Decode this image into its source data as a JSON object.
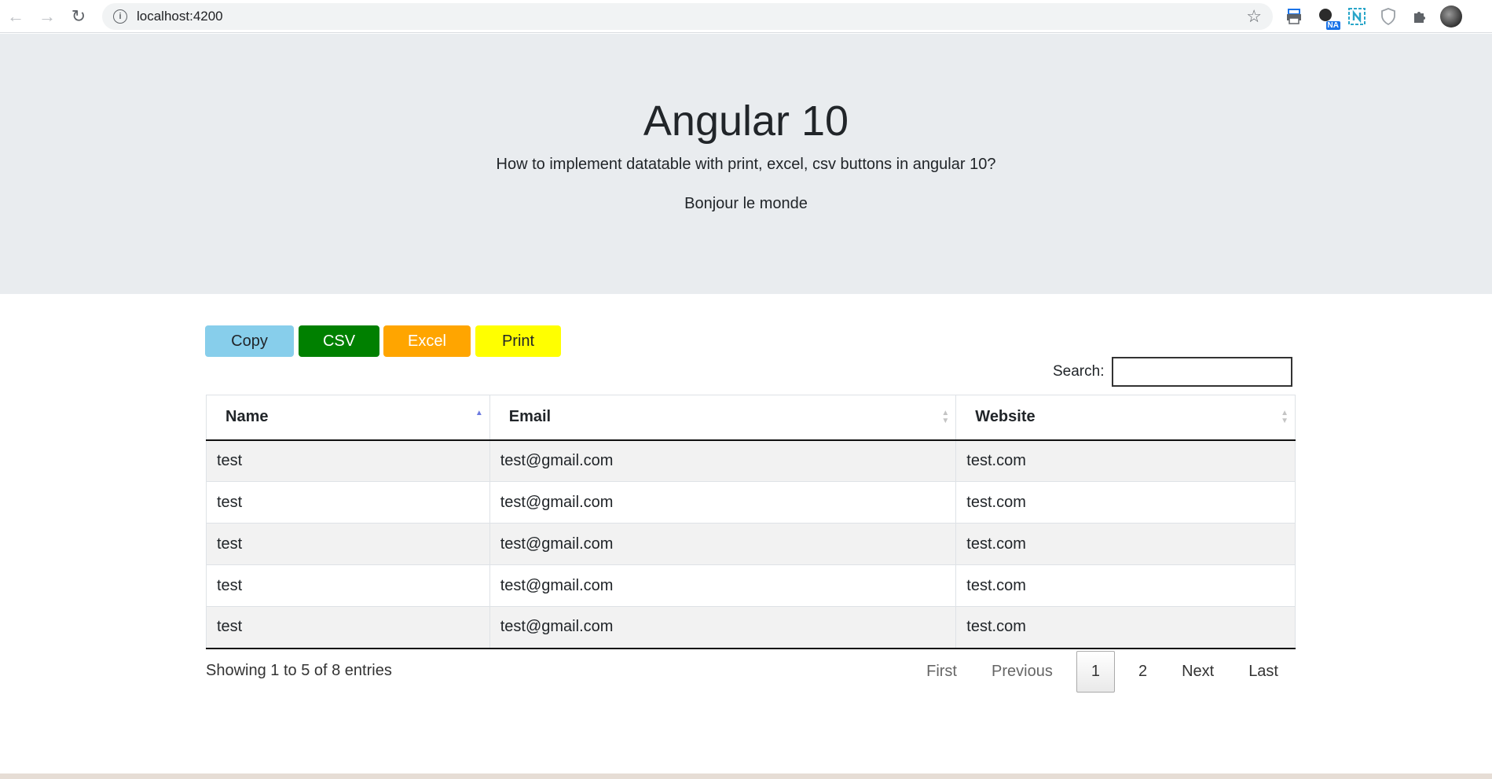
{
  "browser": {
    "url": "localhost:4200",
    "extension_badge": "NA"
  },
  "hero": {
    "title": "Angular 10",
    "subtitle": "How to implement datatable with print, excel, csv buttons in angular 10?",
    "greeting": "Bonjour le monde"
  },
  "export_buttons": {
    "copy": "Copy",
    "csv": "CSV",
    "excel": "Excel",
    "print": "Print",
    "colors": {
      "copy": "#87ceeb",
      "csv": "#008000",
      "excel": "#ffa500",
      "print": "#ffff00"
    }
  },
  "search": {
    "label": "Search:",
    "value": ""
  },
  "table": {
    "columns": [
      "Name",
      "Email",
      "Website"
    ],
    "sorted_column": "Name",
    "sort_direction": "ascending",
    "rows": [
      [
        "test",
        "test@gmail.com",
        "test.com"
      ],
      [
        "test",
        "test@gmail.com",
        "test.com"
      ],
      [
        "test",
        "test@gmail.com",
        "test.com"
      ],
      [
        "test",
        "test@gmail.com",
        "test.com"
      ],
      [
        "test",
        "test@gmail.com",
        "test.com"
      ]
    ]
  },
  "footer": {
    "info": "Showing 1 to 5 of 8 entries"
  },
  "pagination": {
    "first": "First",
    "previous": "Previous",
    "pages": [
      "1",
      "2"
    ],
    "current": "1",
    "next": "Next",
    "last": "Last"
  }
}
